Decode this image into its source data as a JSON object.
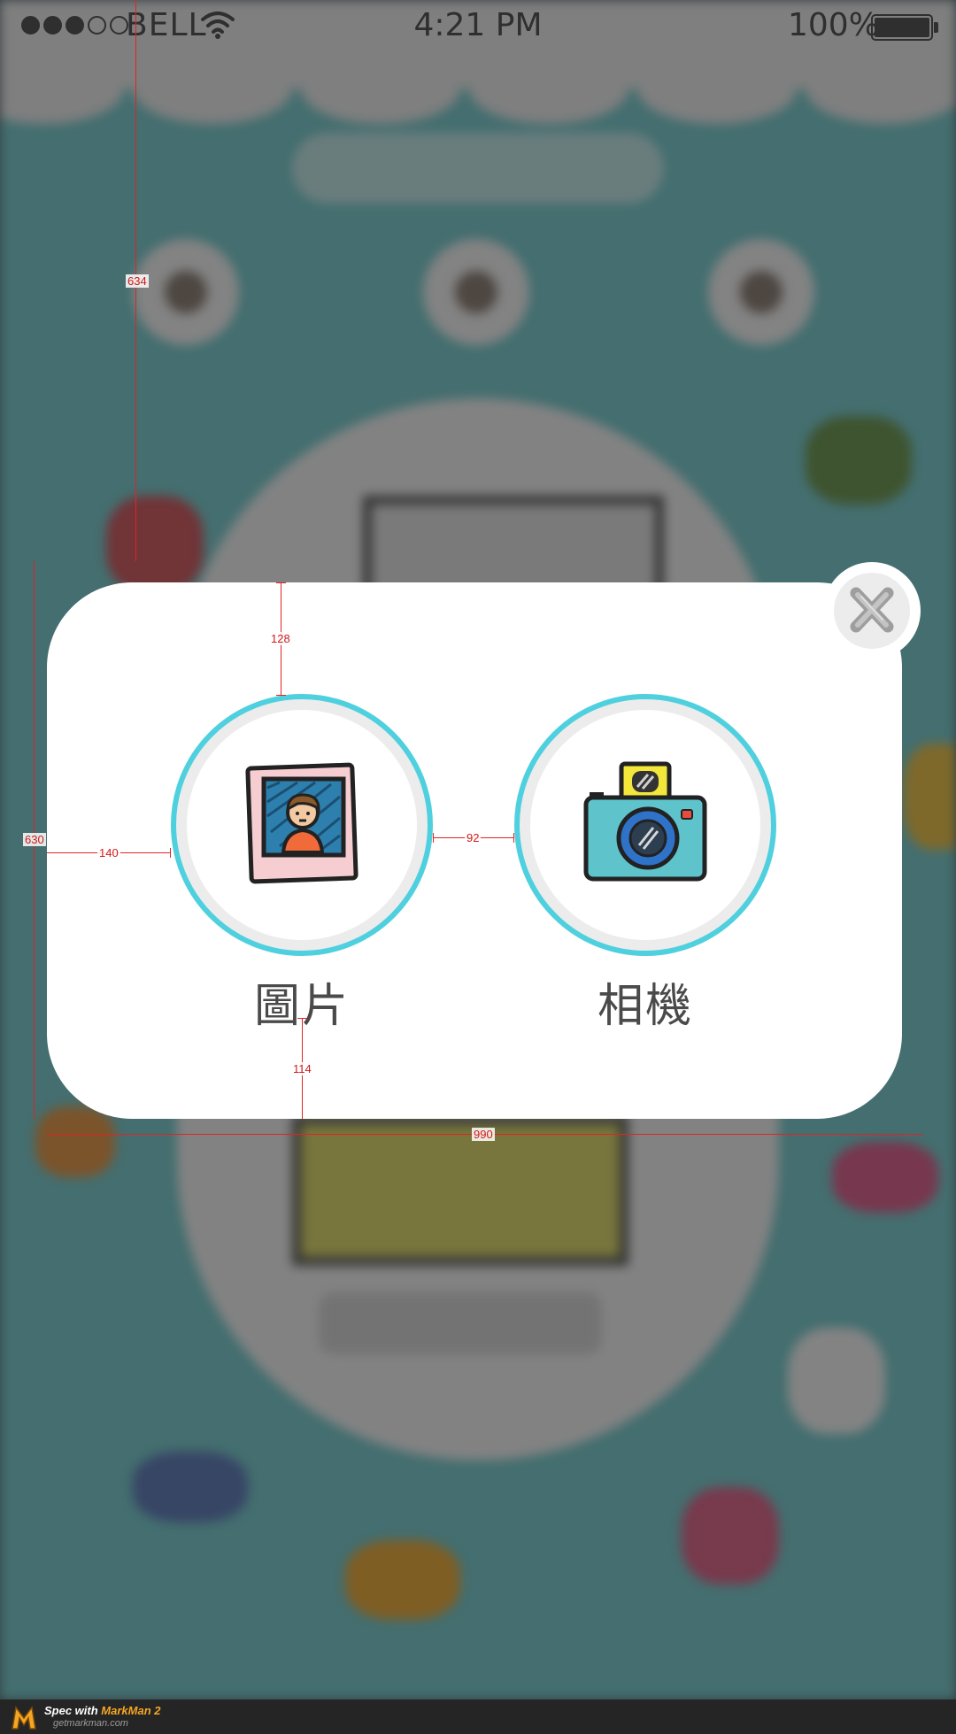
{
  "status_bar": {
    "signal_bars": 5,
    "signal_filled": 3,
    "carrier": "BELL",
    "time": "4:21 PM",
    "battery": "100%"
  },
  "dialog": {
    "options": [
      {
        "label": "圖片",
        "icon": "photo-frame-icon"
      },
      {
        "label": "相機",
        "icon": "camera-icon"
      }
    ],
    "close_icon": "close-x-icon"
  },
  "spec": {
    "top_offset": "634",
    "dialog_height": "630",
    "dialog_width": "990",
    "circle_top_margin": "128",
    "left_margin": "140",
    "circle_gap": "92",
    "label_bottom_margin": "114"
  },
  "footer": {
    "prefix": "Spec with ",
    "brand": "MarkMan 2",
    "url": "getmarkman.com"
  },
  "colors": {
    "accent_ring": "#4fd0de",
    "spec_red": "#e12424",
    "background_teal": "#66c3c6"
  }
}
